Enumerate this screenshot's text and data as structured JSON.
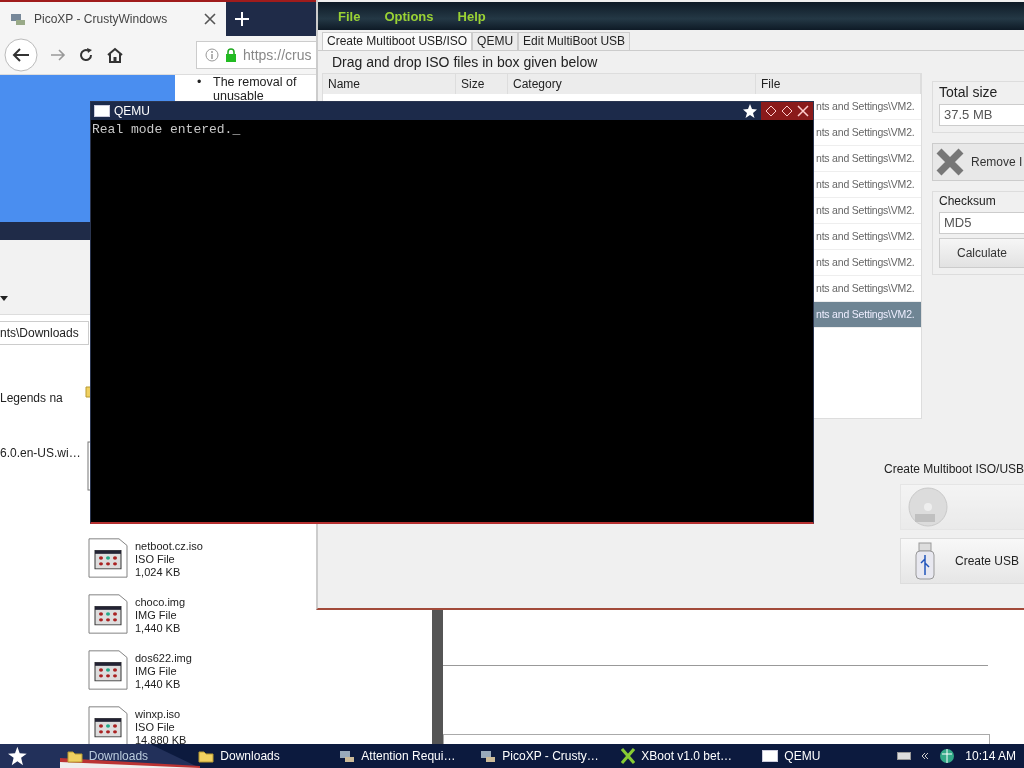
{
  "browser": {
    "tab_title": "PicoXP - CrustyWindows",
    "url": "https://crus",
    "bullets": [
      {
        "marker": "•",
        "text": "The removal of"
      },
      {
        "text": "unusable"
      }
    ]
  },
  "explorer": {
    "address": "nts\\Downloads",
    "items": [
      {
        "name": "Legends na",
        "kind": "folder"
      },
      {
        "name": "6.0.en-US.wi…",
        "kind": "document"
      }
    ],
    "files": [
      {
        "name": "netboot.cz.iso",
        "type": "ISO File",
        "size": "1,024 KB"
      },
      {
        "name": "choco.img",
        "type": "IMG File",
        "size": "1,440 KB"
      },
      {
        "name": "dos622.img",
        "type": "IMG File",
        "size": "1,440 KB"
      },
      {
        "name": "winxp.iso",
        "type": "ISO File",
        "size": "14,880 KB"
      }
    ]
  },
  "xboot": {
    "menu": [
      "File",
      "Options",
      "Help"
    ],
    "tabs": [
      {
        "label": "Create Multiboot USB/ISO",
        "selected": true
      },
      {
        "label": "QEMU",
        "selected": false
      },
      {
        "label": "Edit MultiBoot USB",
        "selected": false
      }
    ],
    "instruction": "Drag and drop ISO files in box given below",
    "table": {
      "columns": [
        "Name",
        "Size",
        "Category",
        "File"
      ],
      "rows": [
        {
          "file": "nts and Settings\\VM2.",
          "selected": false
        },
        {
          "file": "nts and Settings\\VM2.",
          "selected": false
        },
        {
          "file": "nts and Settings\\VM2.",
          "selected": false
        },
        {
          "file": "nts and Settings\\VM2.",
          "selected": false
        },
        {
          "file": "nts and Settings\\VM2.",
          "selected": false
        },
        {
          "file": "nts and Settings\\VM2.",
          "selected": false
        },
        {
          "file": "nts and Settings\\VM2.",
          "selected": false
        },
        {
          "file": "nts and Settings\\VM2.",
          "selected": false
        },
        {
          "file": "nts and Settings\\VM2.",
          "selected": true
        }
      ]
    },
    "total_size": {
      "label": "Total size",
      "value": "37.5 MB"
    },
    "remove_button": "Remove I",
    "checksum": {
      "label": "Checksum",
      "value": "MD5",
      "button": "Calculate"
    },
    "create_group": {
      "label": "Create Multiboot ISO/USB",
      "buttons": [
        {
          "kind": "dvd",
          "disabled": true
        },
        {
          "kind": "usb",
          "label": "Create USB",
          "disabled": false
        }
      ]
    }
  },
  "qemu": {
    "title": "QEMU",
    "console": "Real mode entered._"
  },
  "taskbar": {
    "buttons": [
      {
        "label": "Downloads",
        "kind": "folder"
      },
      {
        "label": "Downloads",
        "kind": "folder"
      },
      {
        "label": "Attention Requi…",
        "kind": "web"
      },
      {
        "label": "PicoXP - Crusty…",
        "kind": "web"
      },
      {
        "label": "XBoot v1.0 bet…",
        "kind": "xboot"
      },
      {
        "label": "QEMU",
        "kind": "window"
      }
    ],
    "clock": "10:14 AM"
  }
}
